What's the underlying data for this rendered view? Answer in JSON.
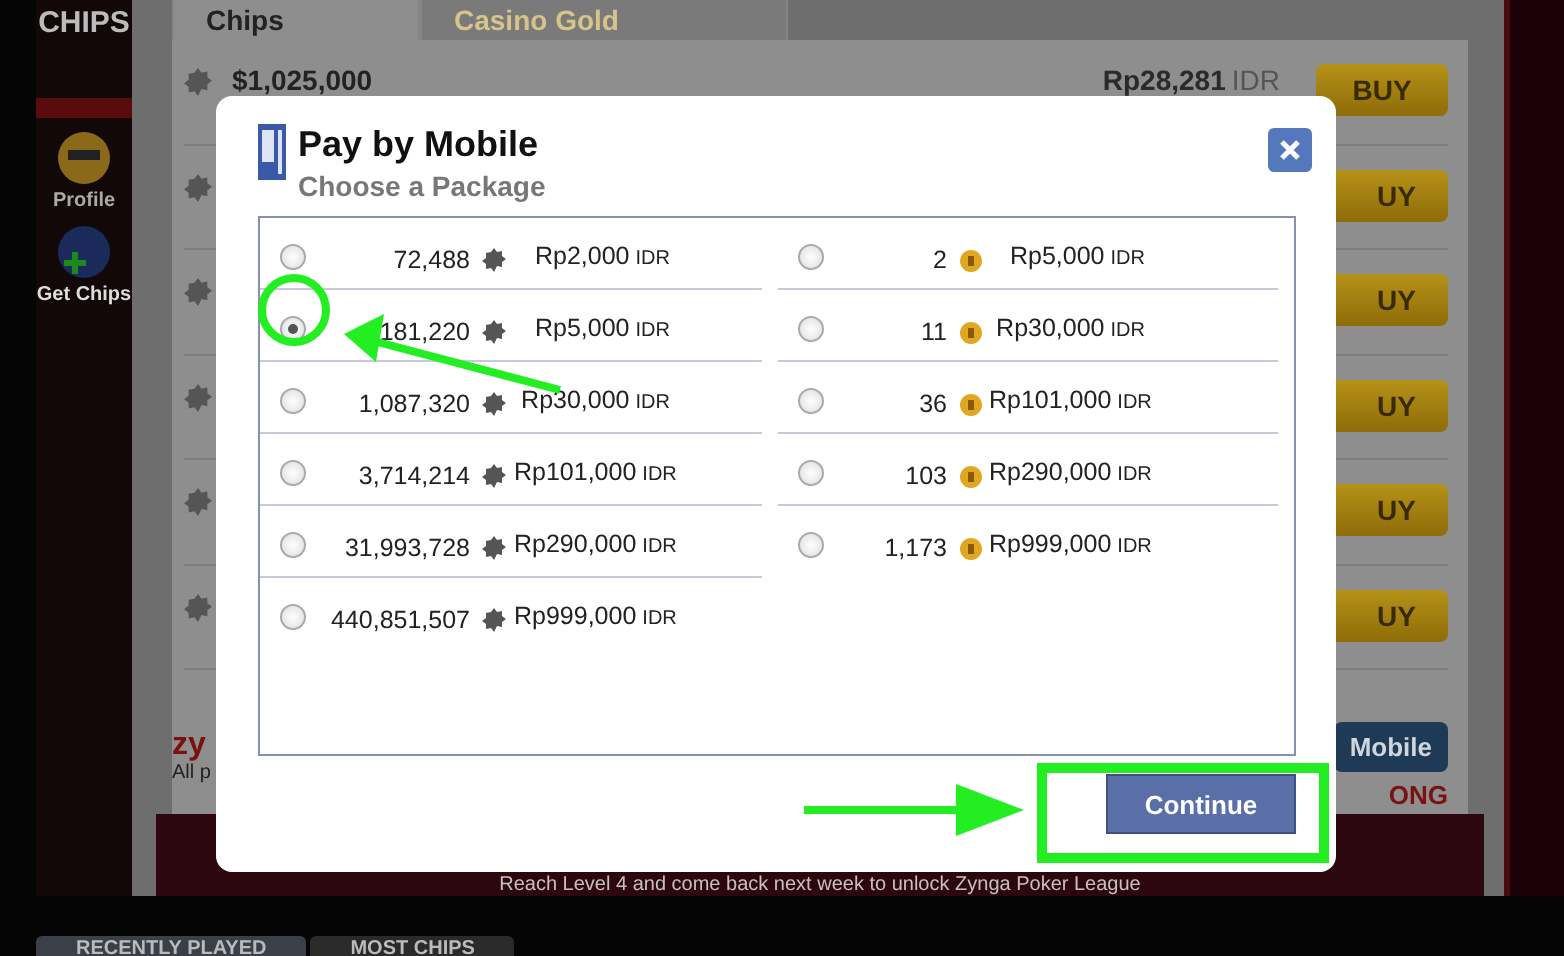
{
  "sidebar": {
    "brand": "CHIPS",
    "items": [
      {
        "label": "Profile",
        "kind": "profile"
      },
      {
        "label": "Get Chips",
        "kind": "chips"
      }
    ]
  },
  "store": {
    "tabs": [
      {
        "label": "Chips",
        "selected": true
      },
      {
        "label": "Casino Gold",
        "selected": false
      }
    ],
    "offers": [
      {
        "amount": "$1,025,000",
        "price": "Rp28,281",
        "currency": "IDR",
        "button": "BUY"
      },
      {
        "button": "UY"
      },
      {
        "button": "UY"
      },
      {
        "button": "UY"
      },
      {
        "button": "UY"
      },
      {
        "button": "UY"
      }
    ],
    "footer_logo": "zy",
    "footer_text": "All p",
    "mobile_button": "Mobile",
    "partner_logo": "ONG"
  },
  "banner": "Reach Level 4 and come back next week to unlock Zynga Poker League",
  "bottom_tabs": [
    {
      "label": "RECENTLY PLAYED",
      "selected": true
    },
    {
      "label": "MOST CHIPS",
      "selected": false
    }
  ],
  "dialog": {
    "title": "Pay by Mobile",
    "subtitle": "Choose a Package",
    "chip_packages": [
      {
        "amount": "72,488",
        "price": "Rp2,000",
        "currency": "IDR",
        "selected": false
      },
      {
        "amount": "181,220",
        "price": "Rp5,000",
        "currency": "IDR",
        "selected": true
      },
      {
        "amount": "1,087,320",
        "price": "Rp30,000",
        "currency": "IDR",
        "selected": false
      },
      {
        "amount": "3,714,214",
        "price": "Rp101,000",
        "currency": "IDR",
        "selected": false
      },
      {
        "amount": "31,993,728",
        "price": "Rp290,000",
        "currency": "IDR",
        "selected": false
      },
      {
        "amount": "440,851,507",
        "price": "Rp999,000",
        "currency": "IDR",
        "selected": false
      }
    ],
    "gold_packages": [
      {
        "amount": "2",
        "price": "Rp5,000",
        "currency": "IDR",
        "selected": false
      },
      {
        "amount": "11",
        "price": "Rp30,000",
        "currency": "IDR",
        "selected": false
      },
      {
        "amount": "36",
        "price": "Rp101,000",
        "currency": "IDR",
        "selected": false
      },
      {
        "amount": "103",
        "price": "Rp290,000",
        "currency": "IDR",
        "selected": false
      },
      {
        "amount": "1,173",
        "price": "Rp999,000",
        "currency": "IDR",
        "selected": false
      }
    ],
    "button": "Continue"
  }
}
